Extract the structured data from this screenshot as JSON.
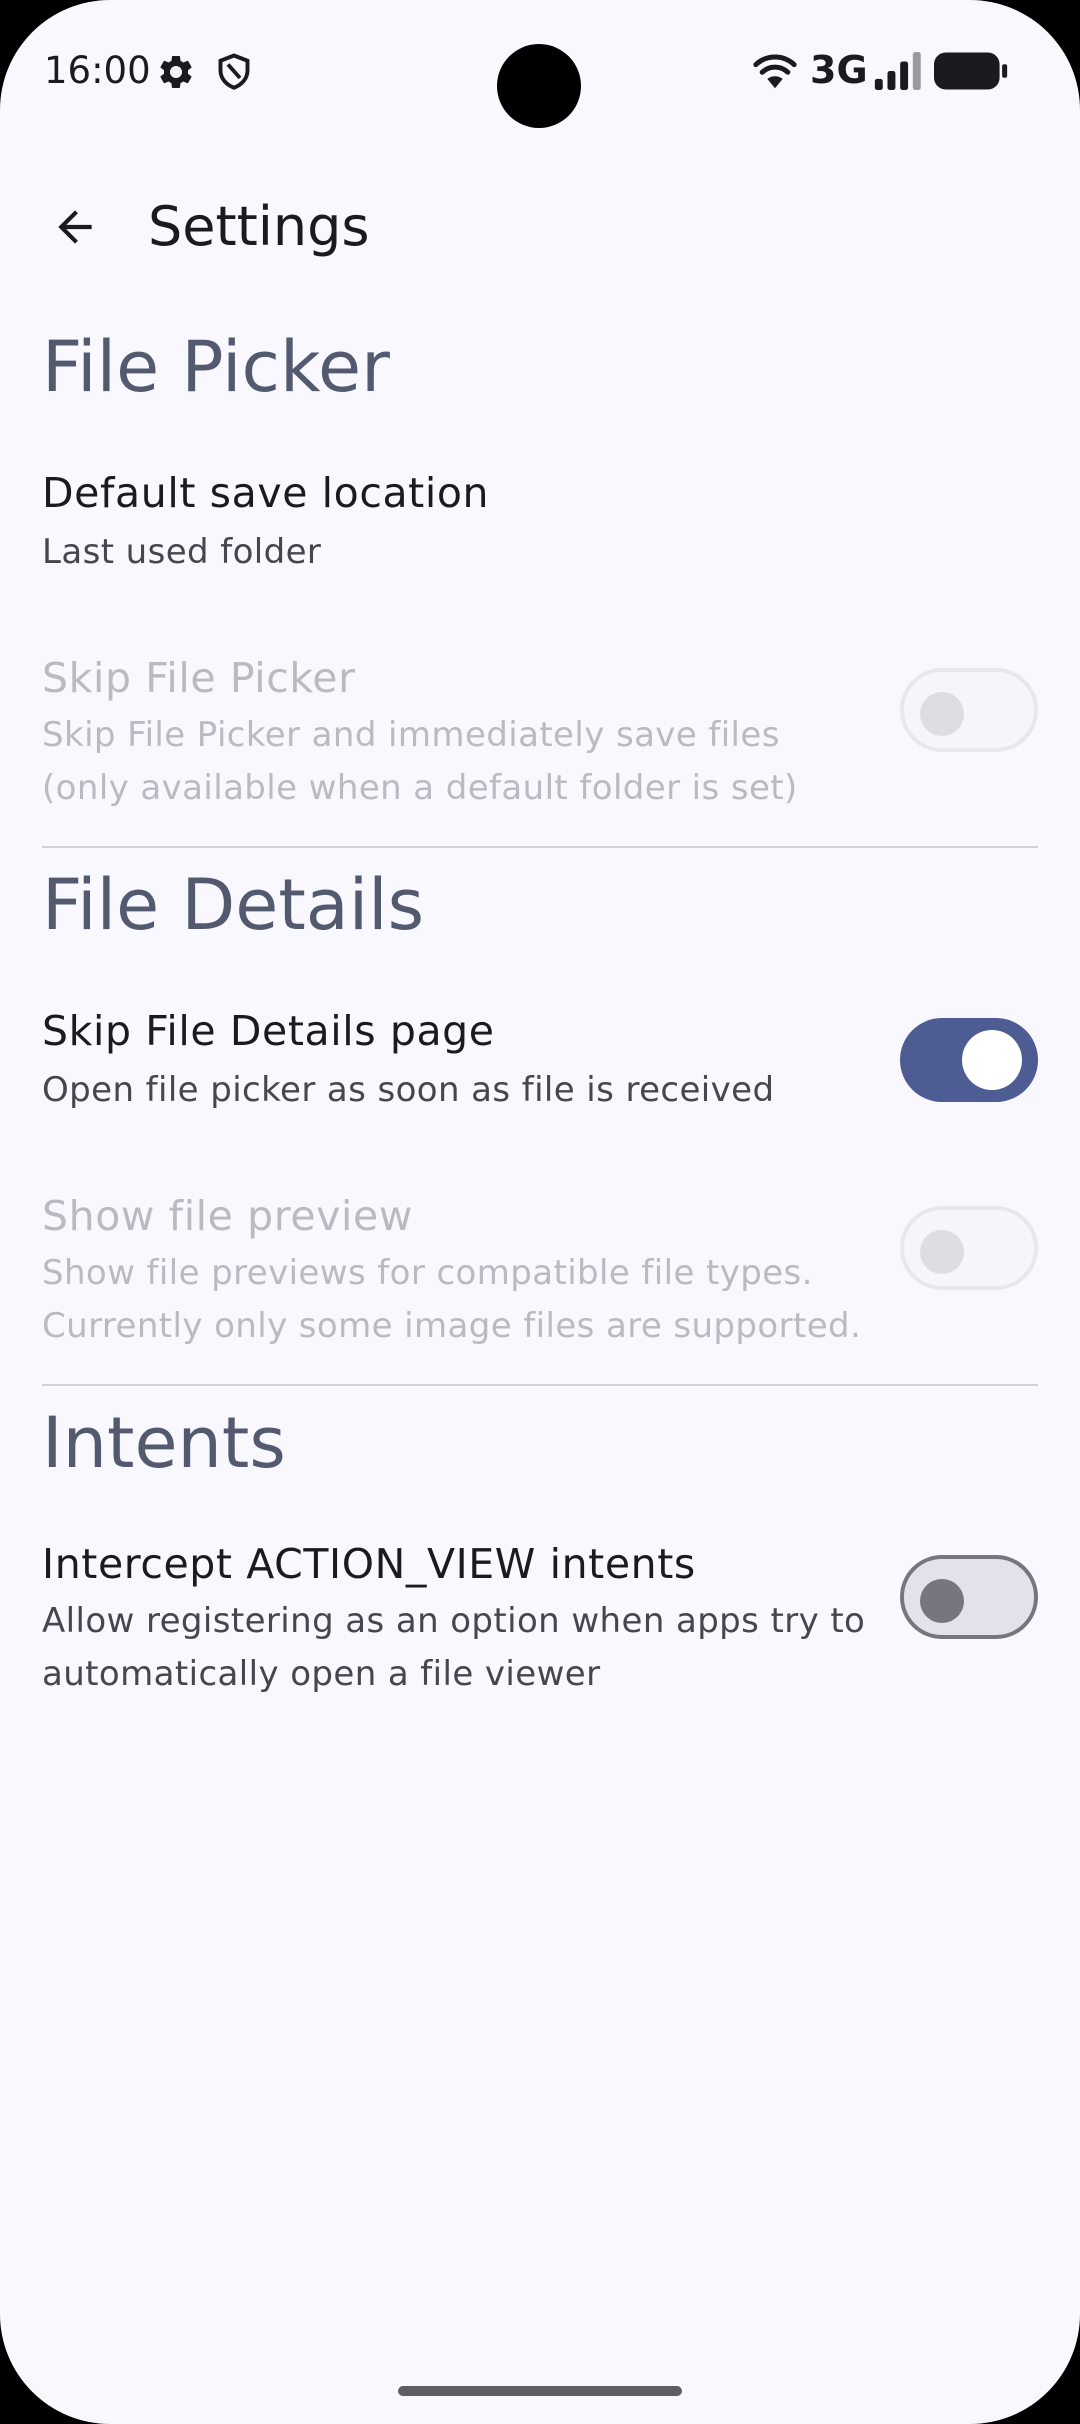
{
  "status_bar": {
    "time": "16:00",
    "network": "3G",
    "icons": [
      "settings-gear-icon",
      "shield-icon",
      "wifi-icon",
      "signal-icon",
      "battery-icon"
    ]
  },
  "app_bar": {
    "title": "Settings",
    "back_icon": "arrow-back-icon"
  },
  "sections": {
    "file_picker": {
      "header": "File Picker",
      "default_save": {
        "title": "Default save location",
        "summary": "Last used folder"
      },
      "skip_picker": {
        "title": "Skip File Picker",
        "summary": "Skip File Picker and immediately save files (only available when a default folder is set)",
        "enabled": false,
        "checked": false
      }
    },
    "file_details": {
      "header": "File Details",
      "skip_details": {
        "title": "Skip File Details page",
        "summary": "Open file picker as soon as file is received",
        "enabled": true,
        "checked": true
      },
      "show_preview": {
        "title": "Show file preview",
        "summary": "Show file previews for compatible file types. Currently only some image files are supported.",
        "enabled": false,
        "checked": false
      }
    },
    "intents": {
      "header": "Intents",
      "intercept": {
        "title": "Intercept ACTION_VIEW intents",
        "summary": "Allow registering as an option when apps try to automatically open a file viewer",
        "enabled": true,
        "checked": false
      }
    }
  },
  "colors": {
    "background": "#f9f8fe",
    "accent": "#4d5c92",
    "section_header": "#535a70",
    "disabled_text": "#babac2"
  }
}
